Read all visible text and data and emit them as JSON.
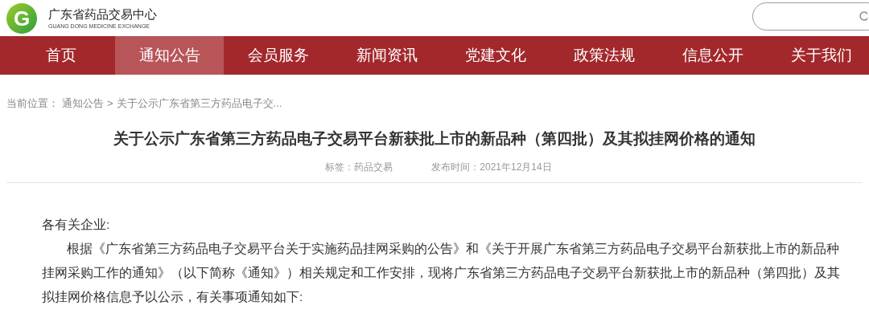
{
  "header": {
    "site_name": "广东省药品交易中心",
    "site_name_en": "GUANG DONG MEDICINE EXCHANGE",
    "logo_letter": "G"
  },
  "nav": [
    {
      "label": "首页",
      "selected": false
    },
    {
      "label": "通知公告",
      "selected": true
    },
    {
      "label": "会员服务",
      "selected": false
    },
    {
      "label": "新闻资讯",
      "selected": false
    },
    {
      "label": "党建文化",
      "selected": false
    },
    {
      "label": "政策法规",
      "selected": false
    },
    {
      "label": "信息公开",
      "selected": false
    },
    {
      "label": "关于我们",
      "selected": false
    }
  ],
  "breadcrumb": {
    "prefix": "当前位置：",
    "items": [
      "通知公告",
      "关于公示广东省第三方药品电子交..."
    ],
    "separator": ">"
  },
  "article": {
    "title": "关于公示广东省第三方药品电子交易平台新获批上市的新品种（第四批）及其拟挂网价格的通知",
    "tag": "标签：药品交易",
    "date": "发布时间：2021年12月14日",
    "greeting": "各有关企业:",
    "paragraphs": [
      "根据《广东省第三方药品电子交易平台关于实施药品挂网采购的公告》和《关于开展广东省第三方药品电子交易平台新获批上市的新品种挂网采购工作的通知》（以下简称《通知》）相关规定和工作安排，现将广东省第三方药品电子交易平台新获批上市的新品种（第四批）及其拟挂网价格信息予以公示，有关事项通知如下:"
    ]
  }
}
